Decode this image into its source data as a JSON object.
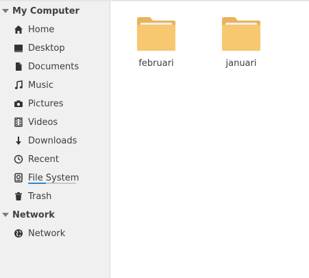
{
  "sidebar": {
    "sections": [
      {
        "title": "My Computer",
        "items": [
          {
            "label": "Home",
            "icon": "home-icon"
          },
          {
            "label": "Desktop",
            "icon": "desktop-icon"
          },
          {
            "label": "Documents",
            "icon": "document-icon"
          },
          {
            "label": "Music",
            "icon": "music-icon"
          },
          {
            "label": "Pictures",
            "icon": "camera-icon"
          },
          {
            "label": "Videos",
            "icon": "film-icon"
          },
          {
            "label": "Downloads",
            "icon": "download-icon"
          },
          {
            "label": "Recent",
            "icon": "clock-icon"
          },
          {
            "label": "File System",
            "icon": "drive-icon",
            "usage_fraction": 0.37
          },
          {
            "label": "Trash",
            "icon": "trash-icon"
          }
        ]
      },
      {
        "title": "Network",
        "items": [
          {
            "label": "Network",
            "icon": "globe-icon"
          }
        ]
      }
    ]
  },
  "content": {
    "folders": [
      {
        "name": "februari",
        "icon": "folder-icon"
      },
      {
        "name": "januari",
        "icon": "folder-icon"
      }
    ]
  },
  "colors": {
    "folder": "#f7c870",
    "folder_back": "#e9b35a",
    "sidebar_bg": "#f0f0f0",
    "usage_bar": "#3584c6"
  }
}
